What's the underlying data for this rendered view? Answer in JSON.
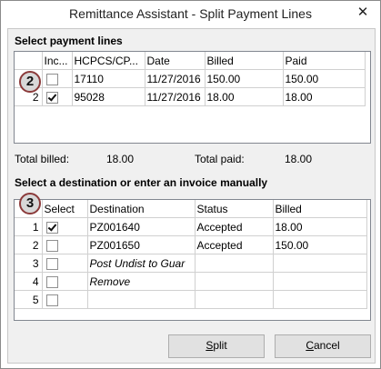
{
  "window": {
    "title": "Remittance Assistant - Split Payment Lines",
    "close_glyph": "✕"
  },
  "payment_lines": {
    "section_title": "Select payment lines",
    "badge": "2",
    "columns": [
      "Inc...",
      "HCPCS/CP...",
      "Date",
      "Billed",
      "Paid"
    ],
    "rows": [
      {
        "num": "",
        "checked": false,
        "code": "17110",
        "date": "11/27/2016",
        "billed": "150.00",
        "paid": "150.00"
      },
      {
        "num": "2",
        "checked": true,
        "code": "95028",
        "date": "11/27/2016",
        "billed": "18.00",
        "paid": "18.00"
      }
    ]
  },
  "totals": {
    "billed_label": "Total billed:",
    "billed_value": "18.00",
    "paid_label": "Total paid:",
    "paid_value": "18.00"
  },
  "destinations": {
    "section_title": "Select a destination or enter an invoice manually",
    "badge": "3",
    "columns": [
      "Select",
      "Destination",
      "Status",
      "Billed"
    ],
    "rows": [
      {
        "num": "1",
        "checked": true,
        "destination": "PZ001640",
        "status": "Accepted",
        "billed": "18.00"
      },
      {
        "num": "2",
        "checked": false,
        "destination": "PZ001650",
        "status": "Accepted",
        "billed": "150.00"
      },
      {
        "num": "3",
        "checked": false,
        "destination": "Post Undist to Guar",
        "status": "",
        "billed": ""
      },
      {
        "num": "4",
        "checked": false,
        "destination": "Remove",
        "status": "",
        "billed": ""
      },
      {
        "num": "5",
        "checked": false,
        "destination": "",
        "status": "",
        "billed": ""
      }
    ]
  },
  "buttons": {
    "split_u": "S",
    "split_rest": "plit",
    "cancel_u": "C",
    "cancel_rest": "ancel"
  }
}
